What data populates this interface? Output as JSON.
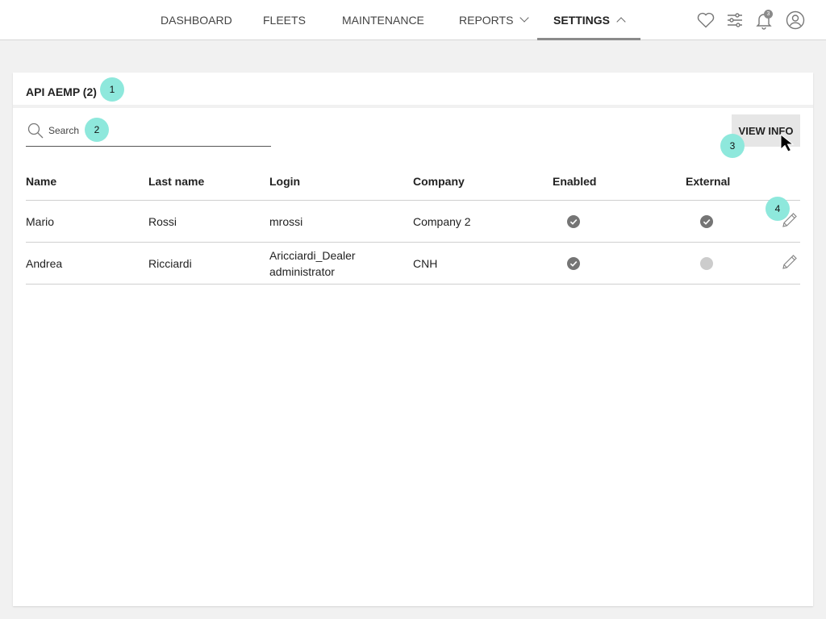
{
  "nav": {
    "dashboard": "DASHBOARD",
    "fleets": "FLEETS",
    "maintenance": "MAINTENANCE",
    "reports": "REPORTS",
    "settings": "SETTINGS",
    "notification_count": "3"
  },
  "card": {
    "title": "API AEMP (2)",
    "search_placeholder": "Search",
    "view_info_label": "VIEW INFO"
  },
  "markers": [
    "1",
    "2",
    "3",
    "4"
  ],
  "table": {
    "headers": [
      "Name",
      "Last name",
      "Login",
      "Company",
      "Enabled",
      "External"
    ],
    "rows": [
      {
        "name": "Mario",
        "last_name": "Rossi",
        "login_line1": "mrossi",
        "login_line2": "",
        "company": "Company 2",
        "enabled": true,
        "external": true
      },
      {
        "name": "Andrea",
        "last_name": "Ricciardi",
        "login_line1": "Aricciardi_Dealer",
        "login_line2": "administrator",
        "company": "CNH",
        "enabled": true,
        "external": false
      }
    ]
  },
  "colors": {
    "marker": "#8ee8dc",
    "status_on": "#757575",
    "status_off": "#cccccc",
    "active_tab_underline": "#8a8a8a"
  },
  "icons": {
    "favorite": "heart-icon",
    "filters": "sliders-icon",
    "notifications": "bell-icon",
    "profile": "user-icon",
    "search": "search-icon",
    "edit": "pencil-icon",
    "status_on": "check-circle-icon",
    "status_off": "circle-icon"
  }
}
